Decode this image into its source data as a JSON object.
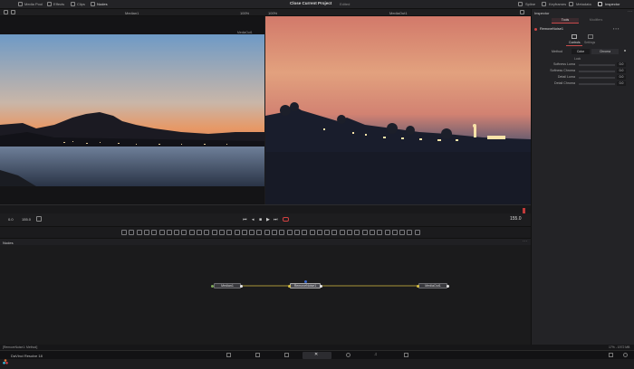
{
  "topbar": {
    "media_pool": "Media Pool",
    "effects": "Effects",
    "clips": "Clips",
    "nodes": "Nodes",
    "project_title": "Close Current Project",
    "edited": "Edited",
    "spline": "Spline",
    "keyframes": "Keyframes",
    "metadata": "Metadata",
    "inspector": "Inspector"
  },
  "viewers": {
    "left_title": "Median1",
    "right_title": "MediaOut1",
    "zoom": "100%",
    "left_tag": "MediaOut1"
  },
  "timeline": {
    "start": "0.0",
    "end": "155.0",
    "current": "155.0"
  },
  "nodes_panel": {
    "title": "Nodes",
    "node1": "Median1",
    "node2": "RemoveNoise1",
    "node3": "MediaOut1"
  },
  "inspector": {
    "title": "Inspector",
    "tab_tools": "Tools",
    "tab_modifiers": "Modifiers",
    "node_name": "RemoveNoise1",
    "sub_controls": "Controls",
    "sub_settings": "Settings",
    "method_label": "Method",
    "method_opt1": "Color",
    "method_opt2": "Chroma",
    "lock_label": "Lock",
    "rows": [
      {
        "label": "Softness Luma",
        "value": "0.0"
      },
      {
        "label": "Softness Chroma",
        "value": "0.0"
      },
      {
        "label": "Detail Luma",
        "value": "0.0"
      },
      {
        "label": "Detail Chroma",
        "value": "0.0"
      }
    ]
  },
  "status": {
    "left": "[RemoveNoise1: Method]",
    "right": "17% - 1972 MB"
  },
  "app": {
    "name": "DaVinci Resolve 18"
  }
}
